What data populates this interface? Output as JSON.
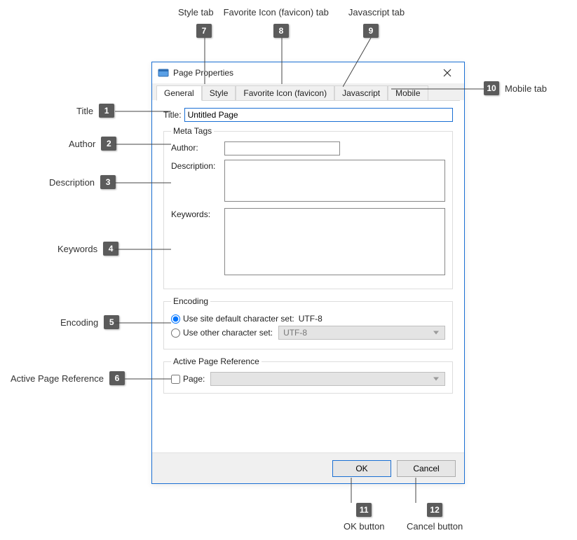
{
  "dialog": {
    "title": "Page Properties"
  },
  "tabs": {
    "general": "General",
    "style": "Style",
    "favicon": "Favorite Icon (favicon)",
    "javascript": "Javascript",
    "mobile": "Mobile"
  },
  "fields": {
    "title_label": "Title:",
    "title_value": "Untitled Page",
    "meta_legend": "Meta Tags",
    "author_label": "Author:",
    "author_value": "",
    "description_label": "Description:",
    "description_value": "",
    "keywords_label": "Keywords:",
    "keywords_value": "",
    "encoding_legend": "Encoding",
    "enc_default_label": "Use site default character set:",
    "enc_default_value": "UTF-8",
    "enc_other_label": "Use other character set:",
    "enc_other_value": "UTF-8",
    "apr_legend": "Active Page Reference",
    "apr_check_label": "Page:"
  },
  "buttons": {
    "ok": "OK",
    "cancel": "Cancel"
  },
  "annotations": {
    "a1": {
      "num": "1",
      "label": "Title"
    },
    "a2": {
      "num": "2",
      "label": "Author"
    },
    "a3": {
      "num": "3",
      "label": "Description"
    },
    "a4": {
      "num": "4",
      "label": "Keywords"
    },
    "a5": {
      "num": "5",
      "label": "Encoding"
    },
    "a6": {
      "num": "6",
      "label": "Active Page Reference"
    },
    "a7": {
      "num": "7",
      "label": "Style tab"
    },
    "a8": {
      "num": "8",
      "label": "Favorite Icon (favicon) tab"
    },
    "a9": {
      "num": "9",
      "label": "Javascript tab"
    },
    "a10": {
      "num": "10",
      "label": "Mobile tab"
    },
    "a11": {
      "num": "11",
      "label": "OK button"
    },
    "a12": {
      "num": "12",
      "label": "Cancel button"
    }
  }
}
